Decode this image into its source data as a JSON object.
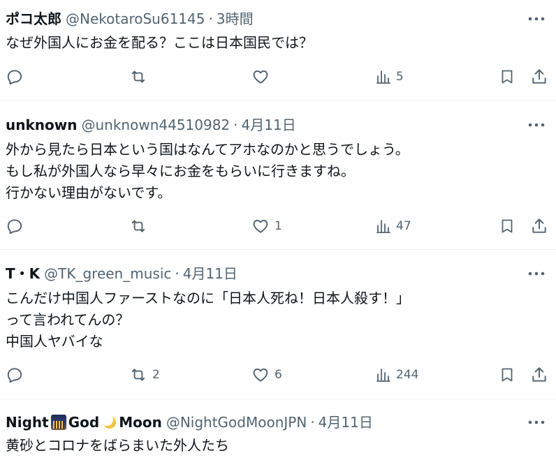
{
  "tweets": [
    {
      "name": "ポコ太郎",
      "handle": "@NekotaroSu61145",
      "separator": "·",
      "time": "3時間",
      "text": "なぜ外国人にお金を配る？ここは日本国民では？",
      "retweets": "",
      "likes": "",
      "views": "5"
    },
    {
      "name": "unknown",
      "handle": "@unknown44510982",
      "separator": "·",
      "time": "4月11日",
      "text": "外から見たら日本という国はなんてアホなのかと思うでしょう。\nもし私が外国人なら早々にお金をもらいに行きますね。\n行かない理由がないです。",
      "retweets": "",
      "likes": "1",
      "views": "47"
    },
    {
      "name": "T・K",
      "handle": "@TK_green_music",
      "separator": "·",
      "time": "4月11日",
      "text": "こんだけ中国人ファーストなのに「日本人死ね！日本人殺す！」\nって言われてんの？\n中国人ヤバイな",
      "retweets": "2",
      "likes": "6",
      "views": "244"
    },
    {
      "name_part1": "Night",
      "name_emoji1": "night-city-emoji",
      "name_part2": "God",
      "name_emoji2": "crescent-moon-emoji",
      "name_part3": "Moon",
      "handle": "@NightGodMoonJPN",
      "separator": "·",
      "time": "4月11日",
      "text": "黄砂とコロナをばらまいた外人たち"
    }
  ],
  "icons": {
    "reply": "reply-icon",
    "retweet": "retweet-icon",
    "like": "heart-icon",
    "views": "views-icon",
    "bookmark": "bookmark-icon",
    "share": "share-icon",
    "more": "more-icon"
  },
  "colors": {
    "text": "#0f1419",
    "secondary": "#536471",
    "divider": "#eff3f4",
    "background": "#ffffff"
  }
}
